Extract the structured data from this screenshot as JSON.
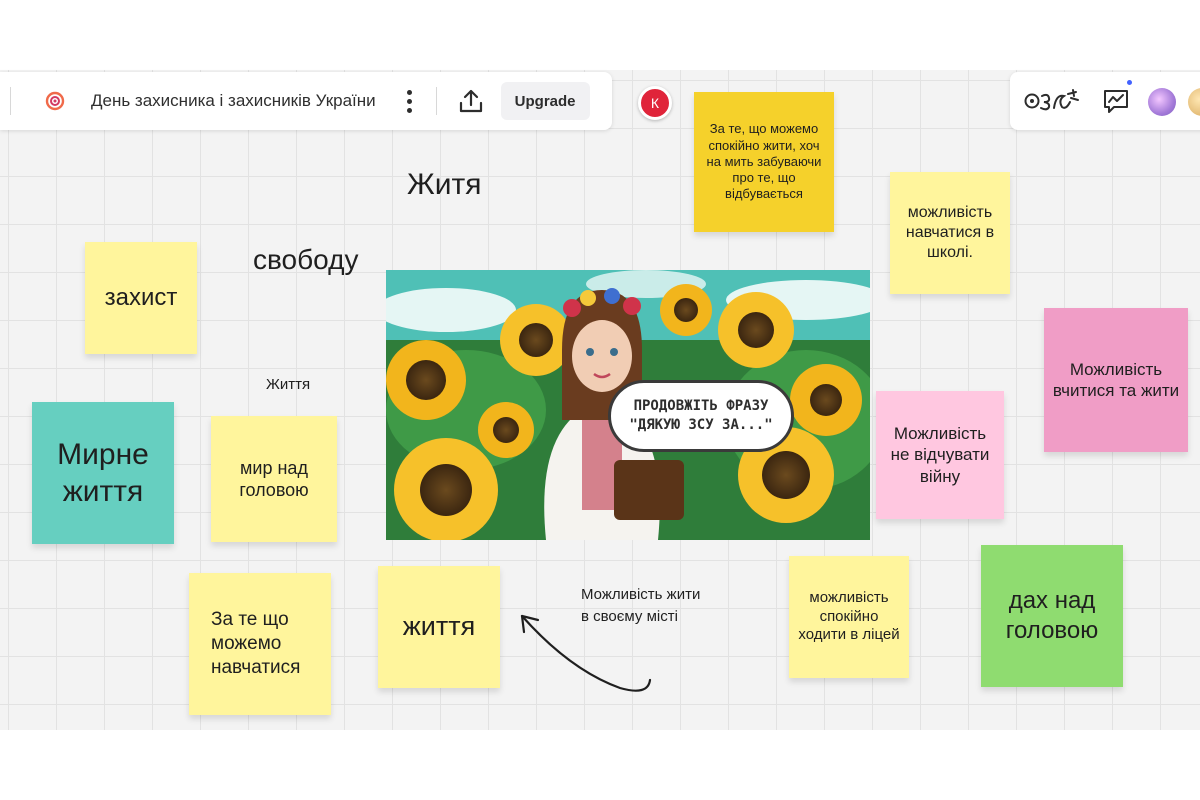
{
  "toolbar": {
    "board_title": "День захисника і захисників України",
    "upgrade_label": "Upgrade",
    "icons": [
      "board-logo-icon",
      "more-menu-icon",
      "upload-icon"
    ]
  },
  "collaborator": {
    "initial": "К",
    "color": "#e0243a"
  },
  "toolbar_right": {
    "icons": [
      "reactions-icon",
      "activity-chart-icon"
    ]
  },
  "image": {
    "bubble_line1": "ПРОДОВЖІТЬ ФРАЗУ",
    "bubble_line2": "\"ДЯКУЮ ЗСУ ЗА...\""
  },
  "notes": [
    {
      "id": "n1",
      "text": "За те, що можемо спокійно жити, хоч на мить забуваючи про те, що відбувається",
      "color": "#f5d12b"
    },
    {
      "id": "n2",
      "text": "можливість навчатися в школі.",
      "color": "#fff59c"
    },
    {
      "id": "n3",
      "text": "захист",
      "color": "#fff59c"
    },
    {
      "id": "n4",
      "text": "Можливість вчитися та жити",
      "color": "#f09dc6"
    },
    {
      "id": "n5",
      "text": "Мирне життя",
      "color": "#66cfc0"
    },
    {
      "id": "n6",
      "text": "мир над головою",
      "color": "#fff59c"
    },
    {
      "id": "n7",
      "text": "Можливість не відчувати війну",
      "color": "#ffc7e0"
    },
    {
      "id": "n8",
      "text": "За те що можемо навчатися",
      "color": "#fff59c"
    },
    {
      "id": "n9",
      "text": "життя",
      "color": "#fff59c"
    },
    {
      "id": "n10",
      "text": "можливість спокійно ходити в ліцей",
      "color": "#fff59c"
    },
    {
      "id": "n11",
      "text": "дах над головою",
      "color": "#8fdc70"
    }
  ],
  "free_texts": {
    "zhytia_large": "Житя",
    "svobodu": "свободу",
    "zhyttia_small": "Життя",
    "mozhlyvist_misto": "Можливість жити в своєму місті"
  }
}
